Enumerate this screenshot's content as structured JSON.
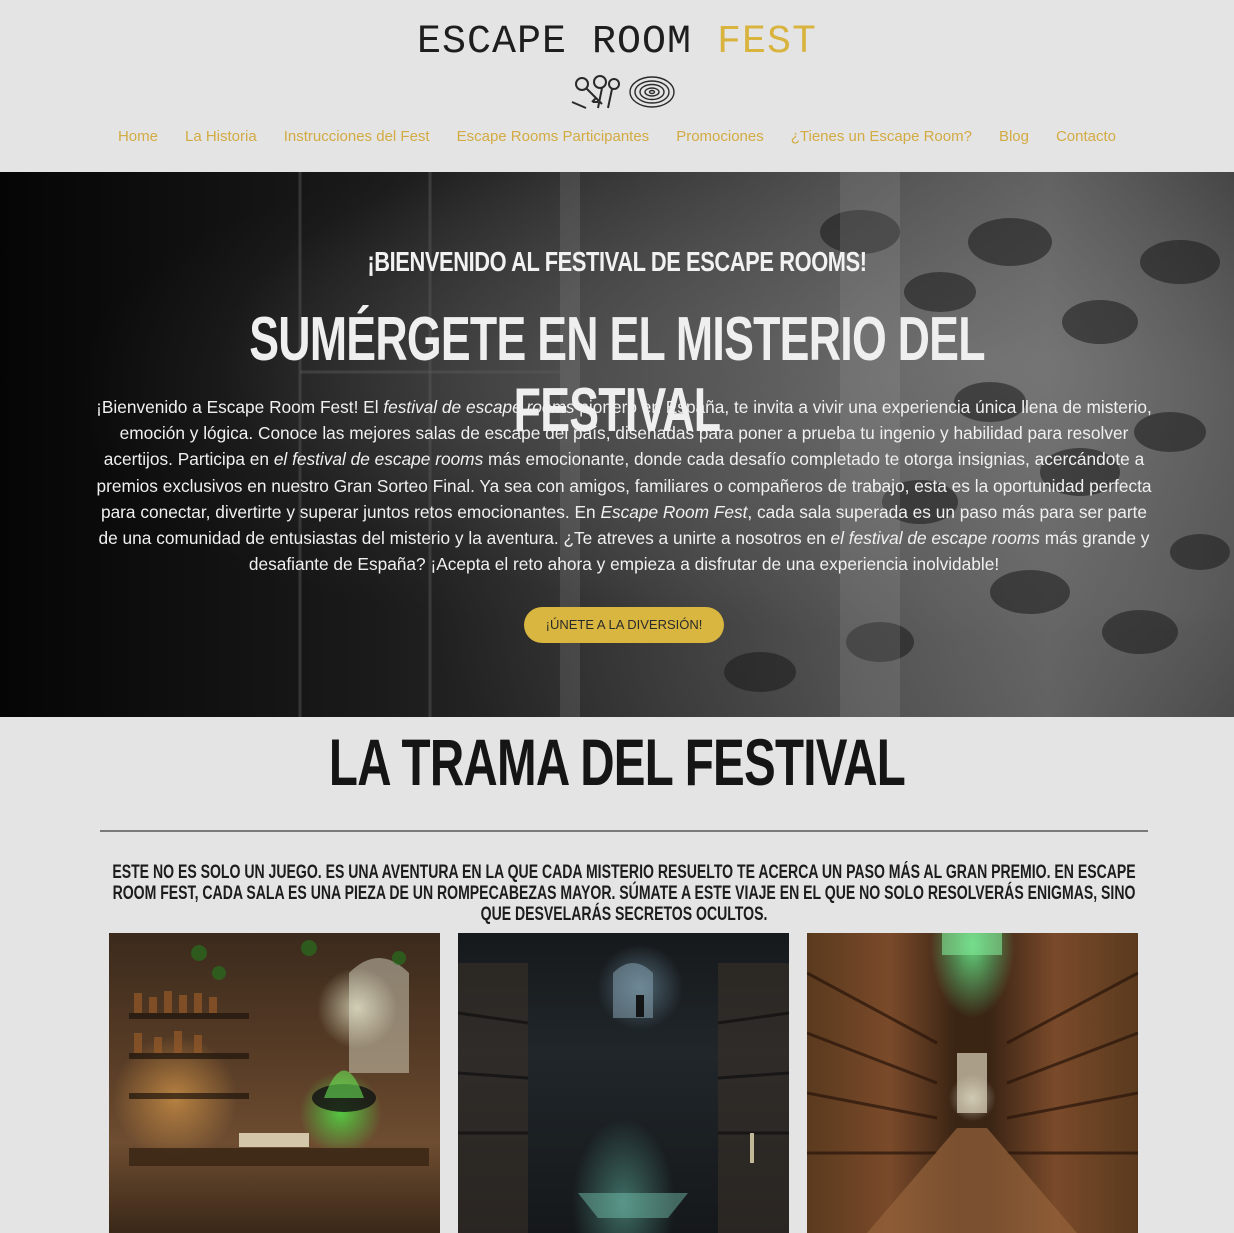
{
  "header": {
    "logo_word1": "ESCAPE ROOM",
    "logo_word2": "FEST",
    "nav": [
      "Home",
      "La Historia",
      "Instrucciones del Fest",
      "Escape Rooms Participantes",
      "Promociones",
      "¿Tienes un Escape Room?",
      "Blog",
      "Contacto"
    ]
  },
  "hero": {
    "kicker": "¡BIENVENIDO AL FESTIVAL DE ESCAPE ROOMS!",
    "title": "SUMÉRGETE EN EL MISTERIO DEL FESTIVAL",
    "paragraph": [
      {
        "t": "¡Bienvenido a Escape Room Fest! El ",
        "i": false
      },
      {
        "t": "festival de escape rooms",
        "i": true
      },
      {
        "t": " pionero en España, te invita a vivir una experiencia única llena de misterio, emoción y lógica. Conoce las mejores salas de escape del país, diseñadas para poner a prueba tu ingenio y habilidad para resolver acertijos. Participa en ",
        "i": false
      },
      {
        "t": "el festival de escape rooms",
        "i": true
      },
      {
        "t": " más emocionante, donde cada desafío completado te otorga insignias, acercándote a premios exclusivos en nuestro Gran Sorteo Final. Ya sea con amigos, familiares o compañeros de trabajo, esta es la oportunidad perfecta para conectar, divertirte y superar juntos retos emocionantes. En ",
        "i": false
      },
      {
        "t": "Escape Room Fest",
        "i": true
      },
      {
        "t": ", cada sala superada es un paso más para ser parte de una comunidad de entusiastas del misterio y la aventura. ¿Te atreves a unirte a nosotros en ",
        "i": false
      },
      {
        "t": "el festival de escape rooms",
        "i": true
      },
      {
        "t": " más grande y desafiante de España? ¡Acepta el reto ahora y empieza a disfrutar de una experiencia inolvidable!",
        "i": false
      }
    ],
    "cta": "¡ÚNETE A LA DIVERSIÓN!"
  },
  "trama": {
    "title": "LA TRAMA DEL FESTIVAL",
    "subtitle": "Este no es solo un juego. Es una aventura en la que cada misterio resuelto te acerca un paso más al gran premio. En Escape Room Fest, cada sala es una pieza de un rompecabezas mayor. Súmate a este viaje en el que no solo resolverás enigmas, sino que desvelarás secretos ocultos.",
    "images": [
      "alchemist-lab-image",
      "dark-library-image",
      "grand-library-image"
    ]
  },
  "colors": {
    "accent": "#d9b63f",
    "nav_text": "#d3ab43",
    "page_bg": "#e4e4e4"
  }
}
